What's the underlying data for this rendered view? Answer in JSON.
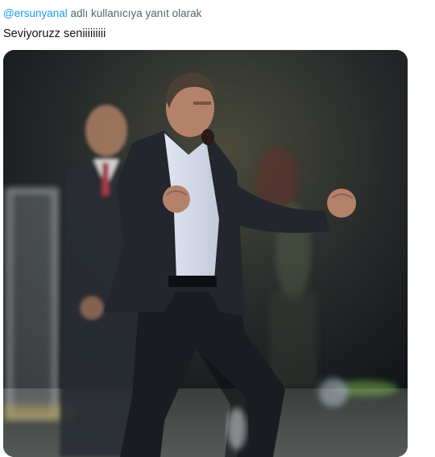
{
  "reply_context": {
    "mention": "@ersunyanal",
    "suffix": " adlı kullanıcıya yanıt olarak"
  },
  "tweet": {
    "text": "Seviyoruzz seniiiiiiiii"
  },
  "media": {
    "type": "photo",
    "subject": "celebrating-coach-photo"
  },
  "colors": {
    "link": "#1d9bf0",
    "secondary_text": "#536471",
    "primary_text": "#0f1419"
  }
}
